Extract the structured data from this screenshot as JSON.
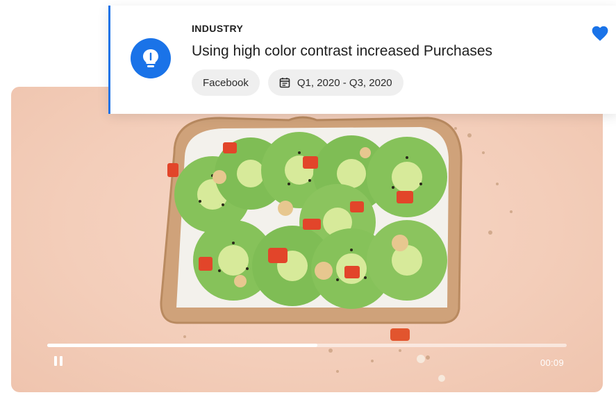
{
  "insight": {
    "category": "INDUSTRY",
    "title": "Using high color contrast increased Purchases",
    "platform_chip": "Facebook",
    "date_range_chip": "Q1, 2020 - Q3, 2020",
    "accent_color": "#1a73e8",
    "favorited": true,
    "icon": "lightbulb-icon"
  },
  "video": {
    "timestamp": "00:09",
    "progress": 0.52,
    "state": "playing",
    "controls": {
      "pause_icon": "pause-icon"
    }
  }
}
